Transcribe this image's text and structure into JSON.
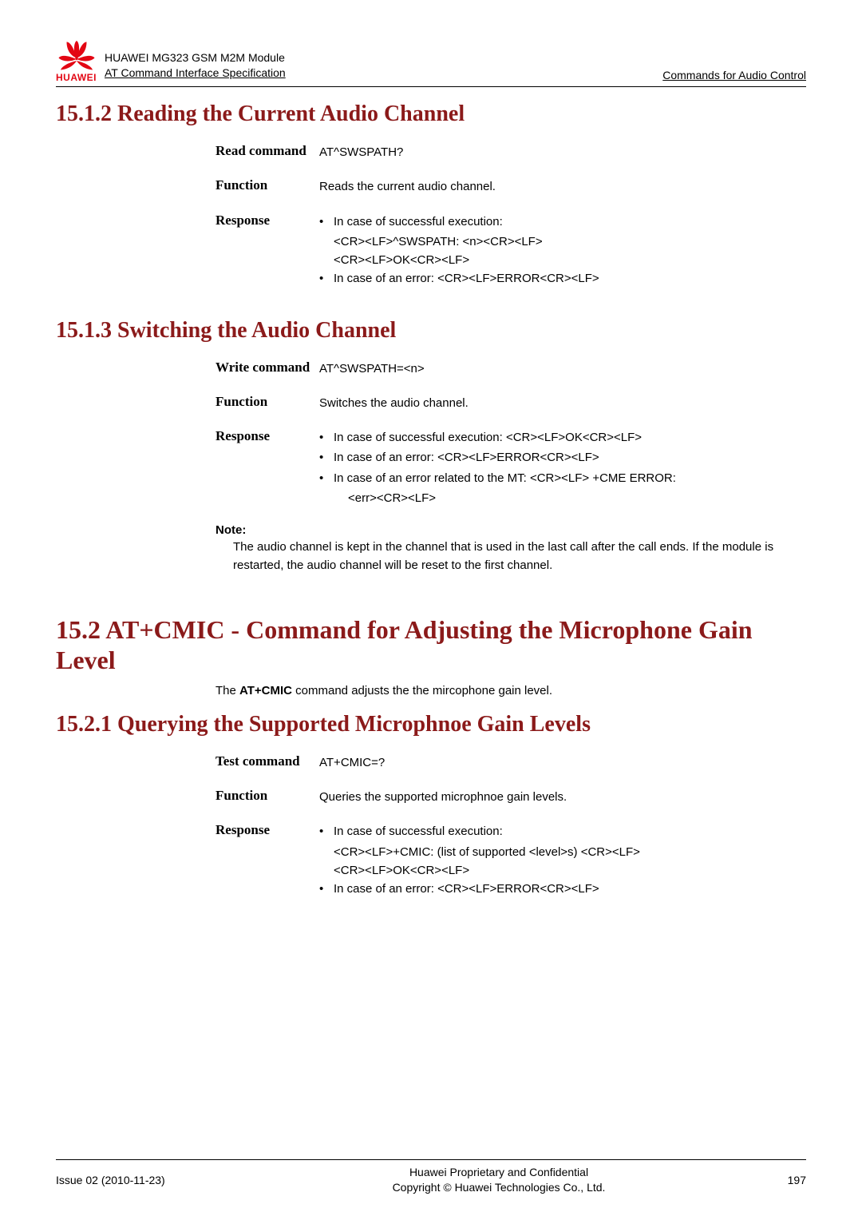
{
  "header": {
    "product": "HUAWEI MG323 GSM M2M Module",
    "subtitle": "AT Command Interface Specification",
    "right": "Commands for Audio Control",
    "brand": "HUAWEI"
  },
  "s1512": {
    "title": "15.1.2 Reading the Current Audio Channel",
    "read_label": "Read command",
    "read_val": "AT^SWSPATH?",
    "func_label": "Function",
    "func_val": "Reads the current audio channel.",
    "resp_label": "Response",
    "resp_b1": "In case of successful execution:",
    "resp_l1": "<CR><LF>^SWSPATH: <n><CR><LF>",
    "resp_l2": "<CR><LF>OK<CR><LF>",
    "resp_b2": "In case of an error: <CR><LF>ERROR<CR><LF>"
  },
  "s1513": {
    "title": "15.1.3 Switching the Audio Channel",
    "write_label": "Write command",
    "write_val": "AT^SWSPATH=<n>",
    "func_label": "Function",
    "func_val": "Switches the audio channel.",
    "resp_label": "Response",
    "resp_b1": "In case of successful execution: <CR><LF>OK<CR><LF>",
    "resp_b2": "In case of an error: <CR><LF>ERROR<CR><LF>",
    "resp_b3a": "In case of an error related to the MT: <CR><LF> +CME ERROR:",
    "resp_b3b": "<err><CR><LF>",
    "note_title": "Note:",
    "note_text": "The audio channel is kept in the channel that is used in the last call after the call ends. If the module is restarted, the audio channel will be reset to the first channel."
  },
  "s152": {
    "title": "15.2 AT+CMIC - Command for Adjusting the Microphone Gain Level",
    "para_pre": "The ",
    "para_bold": "AT+CMIC",
    "para_post": " command adjusts the the mircophone gain level."
  },
  "s1521": {
    "title": "15.2.1 Querying the Supported Microphnoe Gain Levels",
    "test_label": "Test command",
    "test_val": "AT+CMIC=?",
    "func_label": "Function",
    "func_val": "Queries the supported microphnoe gain levels.",
    "resp_label": "Response",
    "resp_b1": "In case of successful execution:",
    "resp_l1": "<CR><LF>+CMIC: (list of supported <level>s) <CR><LF>",
    "resp_l2": "<CR><LF>OK<CR><LF>",
    "resp_b2": "In case of an error: <CR><LF>ERROR<CR><LF>"
  },
  "footer": {
    "left": "Issue 02 (2010-11-23)",
    "center1": "Huawei Proprietary and Confidential",
    "center2": "Copyright © Huawei Technologies Co., Ltd.",
    "right": "197"
  }
}
